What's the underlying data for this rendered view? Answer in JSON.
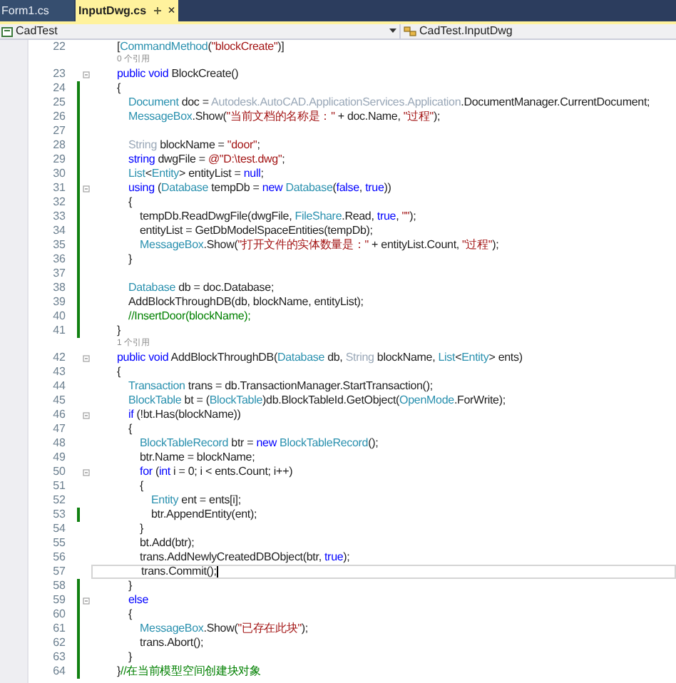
{
  "tabs": [
    {
      "label": "Form1.cs",
      "selected": false
    },
    {
      "label": "InputDwg.cs",
      "selected": true,
      "close": "×"
    }
  ],
  "navigation": {
    "project": "CadTest",
    "class": "CadTest.InputDwg"
  },
  "lines": [
    {
      "kind": "code",
      "number": "22",
      "tokens": [
        {
          "kind": "plain",
          "text": "        ["
        },
        {
          "kind": "type",
          "text": "CommandMethod"
        },
        {
          "kind": "plain",
          "text": "("
        },
        {
          "kind": "string",
          "text": "\"blockCreate\""
        },
        {
          "kind": "plain",
          "text": ")]"
        }
      ]
    },
    {
      "kind": "codelens",
      "text": "        0 个引用"
    },
    {
      "kind": "code",
      "number": "23",
      "fold": true,
      "tokens": [
        {
          "kind": "keyword",
          "text": "        public void"
        },
        {
          "kind": "plain",
          "text": " BlockCreate()"
        }
      ]
    },
    {
      "kind": "code",
      "number": "24",
      "changed": true,
      "tokens": [
        {
          "kind": "plain",
          "text": "        {"
        }
      ]
    },
    {
      "kind": "code",
      "number": "25",
      "changed": true,
      "tokens": [
        {
          "kind": "type",
          "text": "            Document"
        },
        {
          "kind": "plain",
          "text": " doc = "
        },
        {
          "kind": "faded",
          "text": "Autodesk.AutoCAD.ApplicationServices.Application"
        },
        {
          "kind": "plain",
          "text": ".DocumentManager.CurrentDocument;"
        }
      ]
    },
    {
      "kind": "code",
      "number": "26",
      "changed": true,
      "tokens": [
        {
          "kind": "type",
          "text": "            MessageBox"
        },
        {
          "kind": "plain",
          "text": ".Show("
        },
        {
          "kind": "string",
          "text": "\"当前文档的名称是：\""
        },
        {
          "kind": "plain",
          "text": " + doc.Name, "
        },
        {
          "kind": "string",
          "text": "\"过程\""
        },
        {
          "kind": "plain",
          "text": ");"
        }
      ]
    },
    {
      "kind": "code",
      "number": "27",
      "changed": true
    },
    {
      "kind": "code",
      "number": "28",
      "changed": true,
      "tokens": [
        {
          "kind": "faded",
          "text": "            String"
        },
        {
          "kind": "plain",
          "text": " blockName = "
        },
        {
          "kind": "string",
          "text": "\"door\""
        },
        {
          "kind": "plain",
          "text": ";"
        }
      ]
    },
    {
      "kind": "code",
      "number": "29",
      "changed": true,
      "tokens": [
        {
          "kind": "keyword",
          "text": "            string"
        },
        {
          "kind": "plain",
          "text": " dwgFile = "
        },
        {
          "kind": "string",
          "text": "@\"D:\\test.dwg\""
        },
        {
          "kind": "plain",
          "text": ";"
        }
      ]
    },
    {
      "kind": "code",
      "number": "30",
      "changed": true,
      "tokens": [
        {
          "kind": "type",
          "text": "            List"
        },
        {
          "kind": "plain",
          "text": "<"
        },
        {
          "kind": "type",
          "text": "Entity"
        },
        {
          "kind": "plain",
          "text": "> entityList = "
        },
        {
          "kind": "keyword",
          "text": "null"
        },
        {
          "kind": "plain",
          "text": ";"
        }
      ]
    },
    {
      "kind": "code",
      "number": "31",
      "changed": true,
      "fold": true,
      "tokens": [
        {
          "kind": "keyword",
          "text": "            using"
        },
        {
          "kind": "plain",
          "text": " ("
        },
        {
          "kind": "type",
          "text": "Database"
        },
        {
          "kind": "plain",
          "text": " tempDb = "
        },
        {
          "kind": "keyword",
          "text": "new"
        },
        {
          "kind": "type",
          "text": " Database"
        },
        {
          "kind": "plain",
          "text": "("
        },
        {
          "kind": "keyword",
          "text": "false"
        },
        {
          "kind": "plain",
          "text": ", "
        },
        {
          "kind": "keyword",
          "text": "true"
        },
        {
          "kind": "plain",
          "text": "))"
        }
      ]
    },
    {
      "kind": "code",
      "number": "32",
      "changed": true,
      "tokens": [
        {
          "kind": "plain",
          "text": "            {"
        }
      ]
    },
    {
      "kind": "code",
      "number": "33",
      "changed": true,
      "tokens": [
        {
          "kind": "plain",
          "text": "                tempDb.ReadDwgFile(dwgFile, "
        },
        {
          "kind": "type",
          "text": "FileShare"
        },
        {
          "kind": "plain",
          "text": ".Read, "
        },
        {
          "kind": "keyword",
          "text": "true"
        },
        {
          "kind": "plain",
          "text": ", "
        },
        {
          "kind": "string",
          "text": "\"\""
        },
        {
          "kind": "plain",
          "text": ");"
        }
      ]
    },
    {
      "kind": "code",
      "number": "34",
      "changed": true,
      "tokens": [
        {
          "kind": "plain",
          "text": "                entityList = GetDbModelSpaceEntities(tempDb);"
        }
      ]
    },
    {
      "kind": "code",
      "number": "35",
      "changed": true,
      "tokens": [
        {
          "kind": "type",
          "text": "                MessageBox"
        },
        {
          "kind": "plain",
          "text": ".Show("
        },
        {
          "kind": "string",
          "text": "\"打开文件的实体数量是：\""
        },
        {
          "kind": "plain",
          "text": " + entityList.Count, "
        },
        {
          "kind": "string",
          "text": "\"过程\""
        },
        {
          "kind": "plain",
          "text": ");"
        }
      ]
    },
    {
      "kind": "code",
      "number": "36",
      "changed": true,
      "tokens": [
        {
          "kind": "plain",
          "text": "            }"
        }
      ]
    },
    {
      "kind": "code",
      "number": "37",
      "changed": true
    },
    {
      "kind": "code",
      "number": "38",
      "changed": true,
      "tokens": [
        {
          "kind": "type",
          "text": "            Database"
        },
        {
          "kind": "plain",
          "text": " db = doc.Database;"
        }
      ]
    },
    {
      "kind": "code",
      "number": "39",
      "changed": true,
      "tokens": [
        {
          "kind": "plain",
          "text": "            AddBlockThroughDB(db, blockName, entityList);"
        }
      ]
    },
    {
      "kind": "code",
      "number": "40",
      "changed": true,
      "tokens": [
        {
          "kind": "comment",
          "text": "            //InsertDoor(blockName);"
        }
      ]
    },
    {
      "kind": "code",
      "number": "41",
      "changed": true,
      "tokens": [
        {
          "kind": "plain",
          "text": "        }"
        }
      ]
    },
    {
      "kind": "codelens",
      "text": "        1 个引用"
    },
    {
      "kind": "code",
      "number": "42",
      "fold": true,
      "tokens": [
        {
          "kind": "keyword",
          "text": "        public void"
        },
        {
          "kind": "plain",
          "text": " AddBlockThroughDB("
        },
        {
          "kind": "type",
          "text": "Database"
        },
        {
          "kind": "plain",
          "text": " db, "
        },
        {
          "kind": "faded",
          "text": "String"
        },
        {
          "kind": "plain",
          "text": " blockName, "
        },
        {
          "kind": "type",
          "text": "List"
        },
        {
          "kind": "plain",
          "text": "<"
        },
        {
          "kind": "type",
          "text": "Entity"
        },
        {
          "kind": "plain",
          "text": "> ents)"
        }
      ]
    },
    {
      "kind": "code",
      "number": "43",
      "tokens": [
        {
          "kind": "plain",
          "text": "        {"
        }
      ]
    },
    {
      "kind": "code",
      "number": "44",
      "tokens": [
        {
          "kind": "type",
          "text": "            Transaction"
        },
        {
          "kind": "plain",
          "text": " trans = db.TransactionManager.StartTransaction();"
        }
      ]
    },
    {
      "kind": "code",
      "number": "45",
      "tokens": [
        {
          "kind": "type",
          "text": "            BlockTable"
        },
        {
          "kind": "plain",
          "text": " bt = ("
        },
        {
          "kind": "type",
          "text": "BlockTable"
        },
        {
          "kind": "plain",
          "text": ")db.BlockTableId.GetObject("
        },
        {
          "kind": "type",
          "text": "OpenMode"
        },
        {
          "kind": "plain",
          "text": ".ForWrite);"
        }
      ]
    },
    {
      "kind": "code",
      "number": "46",
      "fold": true,
      "tokens": [
        {
          "kind": "keyword",
          "text": "            if"
        },
        {
          "kind": "plain",
          "text": " (!bt.Has(blockName))"
        }
      ]
    },
    {
      "kind": "code",
      "number": "47",
      "tokens": [
        {
          "kind": "plain",
          "text": "            {"
        }
      ]
    },
    {
      "kind": "code",
      "number": "48",
      "tokens": [
        {
          "kind": "type",
          "text": "                BlockTableRecord"
        },
        {
          "kind": "plain",
          "text": " btr = "
        },
        {
          "kind": "keyword",
          "text": "new"
        },
        {
          "kind": "type",
          "text": " BlockTableRecord"
        },
        {
          "kind": "plain",
          "text": "();"
        }
      ]
    },
    {
      "kind": "code",
      "number": "49",
      "tokens": [
        {
          "kind": "plain",
          "text": "                btr.Name = blockName;"
        }
      ]
    },
    {
      "kind": "code",
      "number": "50",
      "fold": true,
      "tokens": [
        {
          "kind": "keyword",
          "text": "                for"
        },
        {
          "kind": "plain",
          "text": " ("
        },
        {
          "kind": "keyword",
          "text": "int"
        },
        {
          "kind": "plain",
          "text": " i = 0; i < ents.Count; i++)"
        }
      ]
    },
    {
      "kind": "code",
      "number": "51",
      "tokens": [
        {
          "kind": "plain",
          "text": "                {"
        }
      ]
    },
    {
      "kind": "code",
      "number": "52",
      "tokens": [
        {
          "kind": "type",
          "text": "                    Entity"
        },
        {
          "kind": "plain",
          "text": " ent = ents[i];"
        }
      ]
    },
    {
      "kind": "code",
      "number": "53",
      "changed": true,
      "tokens": [
        {
          "kind": "plain",
          "text": "                    btr.AppendEntity(ent);"
        }
      ]
    },
    {
      "kind": "code",
      "number": "54",
      "tokens": [
        {
          "kind": "plain",
          "text": "                }"
        }
      ]
    },
    {
      "kind": "code",
      "number": "55",
      "tokens": [
        {
          "kind": "plain",
          "text": "                bt.Add(btr);"
        }
      ]
    },
    {
      "kind": "code",
      "number": "56",
      "tokens": [
        {
          "kind": "plain",
          "text": "                trans.AddNewlyCreatedDBObject(btr, "
        },
        {
          "kind": "keyword",
          "text": "true"
        },
        {
          "kind": "plain",
          "text": ");"
        }
      ]
    },
    {
      "kind": "code",
      "number": "57",
      "current": true,
      "tokens": [
        {
          "kind": "plain",
          "text": "                trans.Commit();"
        }
      ]
    },
    {
      "kind": "code",
      "number": "58",
      "changed": true,
      "tokens": [
        {
          "kind": "plain",
          "text": "            }"
        }
      ]
    },
    {
      "kind": "code",
      "number": "59",
      "changed": true,
      "fold": true,
      "tokens": [
        {
          "kind": "keyword",
          "text": "            else"
        }
      ]
    },
    {
      "kind": "code",
      "number": "60",
      "changed": true,
      "tokens": [
        {
          "kind": "plain",
          "text": "            {"
        }
      ]
    },
    {
      "kind": "code",
      "number": "61",
      "changed": true,
      "tokens": [
        {
          "kind": "type",
          "text": "                MessageBox"
        },
        {
          "kind": "plain",
          "text": ".Show("
        },
        {
          "kind": "string",
          "text": "\"已存在此块\""
        },
        {
          "kind": "plain",
          "text": ");"
        }
      ]
    },
    {
      "kind": "code",
      "number": "62",
      "changed": true,
      "tokens": [
        {
          "kind": "plain",
          "text": "                trans.Abort();"
        }
      ]
    },
    {
      "kind": "code",
      "number": "63",
      "changed": true,
      "tokens": [
        {
          "kind": "plain",
          "text": "            }"
        }
      ]
    },
    {
      "kind": "code",
      "number": "64",
      "changed": true,
      "tokens": [
        {
          "kind": "plain",
          "text": "        }"
        },
        {
          "kind": "comment",
          "text": "//在当前模型空间创建块对象"
        }
      ]
    }
  ]
}
